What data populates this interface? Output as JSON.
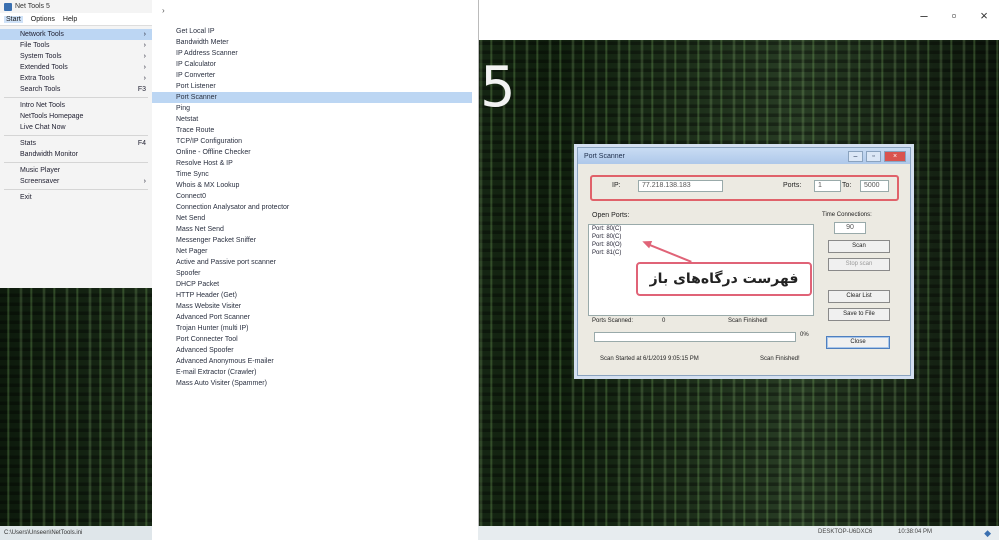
{
  "window": {
    "title": "Net Tools 5",
    "controls": {
      "minimize": "–",
      "maximize": "▫",
      "close": "×"
    },
    "big_number": "5"
  },
  "menubar": [
    "Start",
    "Options",
    "Help"
  ],
  "tool_categories": [
    {
      "label": "Network Tools",
      "arrow": "›",
      "selected": true
    },
    {
      "label": "File Tools",
      "arrow": "›"
    },
    {
      "label": "System Tools",
      "arrow": "›"
    },
    {
      "label": "Extended Tools",
      "arrow": "›"
    },
    {
      "label": "Extra Tools",
      "arrow": "›"
    },
    {
      "label": "Search Tools",
      "arrow": "F3"
    },
    {
      "separator": true
    },
    {
      "label": "Intro Net Tools",
      "arrow": ""
    },
    {
      "label": "NetTools Homepage",
      "arrow": ""
    },
    {
      "label": "Live Chat Now",
      "arrow": ""
    },
    {
      "separator": true
    },
    {
      "label": "Stats",
      "arrow": "F4"
    },
    {
      "label": "Bandwidth Monitor",
      "arrow": ""
    },
    {
      "separator": true
    },
    {
      "label": "Music Player",
      "arrow": ""
    },
    {
      "label": "Screensaver",
      "arrow": "›"
    },
    {
      "separator": true
    },
    {
      "label": "Exit",
      "arrow": ""
    }
  ],
  "left_status": "C:\\Users\\Unseen\\NetTools.ini",
  "submenu_arrow": "›",
  "network_tools": [
    "Get Local IP",
    "Bandwidth Meter",
    "IP Address Scanner",
    "IP Calculator",
    "IP Converter",
    "Port Listener",
    "Port Scanner",
    "Ping",
    "Netstat",
    "Trace Route",
    "TCP/IP Configuration",
    "Online - Offline Checker",
    "Resolve Host & IP",
    "Time Sync",
    "Whois & MX Lookup",
    "Connect0",
    "Connection Analysator and protector",
    "Net Send",
    "Mass Net Send",
    "Messenger Packet Sniffer",
    "Net Pager",
    "Active and Passive port scanner",
    "Spoofer",
    "DHCP Packet",
    "HTTP Header (Get)",
    "Mass Website Visiter",
    "Advanced Port Scanner",
    "Trojan Hunter (multi IP)",
    "Port Connecter Tool",
    "Advanced Spoofer",
    "Advanced Anonymous E-mailer",
    "E-mail Extractor (Crawler)",
    "Mass Auto Visiter (Spammer)"
  ],
  "selected_tool": "Port Scanner",
  "taskbar": {
    "left": "DESKTOP-U6DXC6",
    "right": "10:38:04 PM",
    "icon": "◆"
  },
  "port_scanner": {
    "title": "Port Scanner",
    "title_buttons": {
      "min": "–",
      "max": "▫",
      "close": "×"
    },
    "ip_label": "IP:",
    "ip_value": "77.218.138.183",
    "ports_label": "Ports:",
    "port_from": "1",
    "to_label": "To:",
    "port_to": "5000",
    "open_ports_label": "Open Ports:",
    "open_ports": [
      "Port: 80(C)",
      "Port: 80(C)",
      "Port: 80(O)",
      "Port: 81(C)"
    ],
    "timeout_label": "Time Connections:",
    "timeout_value": "90",
    "scan_button": "Scan",
    "stop_button": "Stop scan",
    "clear_button": "Clear List",
    "save_button": "Save to File",
    "ports_scanned_label": "Ports Scanned:",
    "ports_scanned_value": "0",
    "scan_finished_label": "Scan Finished!",
    "progress_percent": "0%",
    "progress_value": 0.0,
    "close_button": "Close",
    "started_text": "Scan Started at 6/1/2019 9:05:15 PM",
    "finished_text": "Scan Finished!"
  },
  "callout": {
    "text": "فهرست درگاه‌های باز",
    "border_color": "#e06377"
  }
}
